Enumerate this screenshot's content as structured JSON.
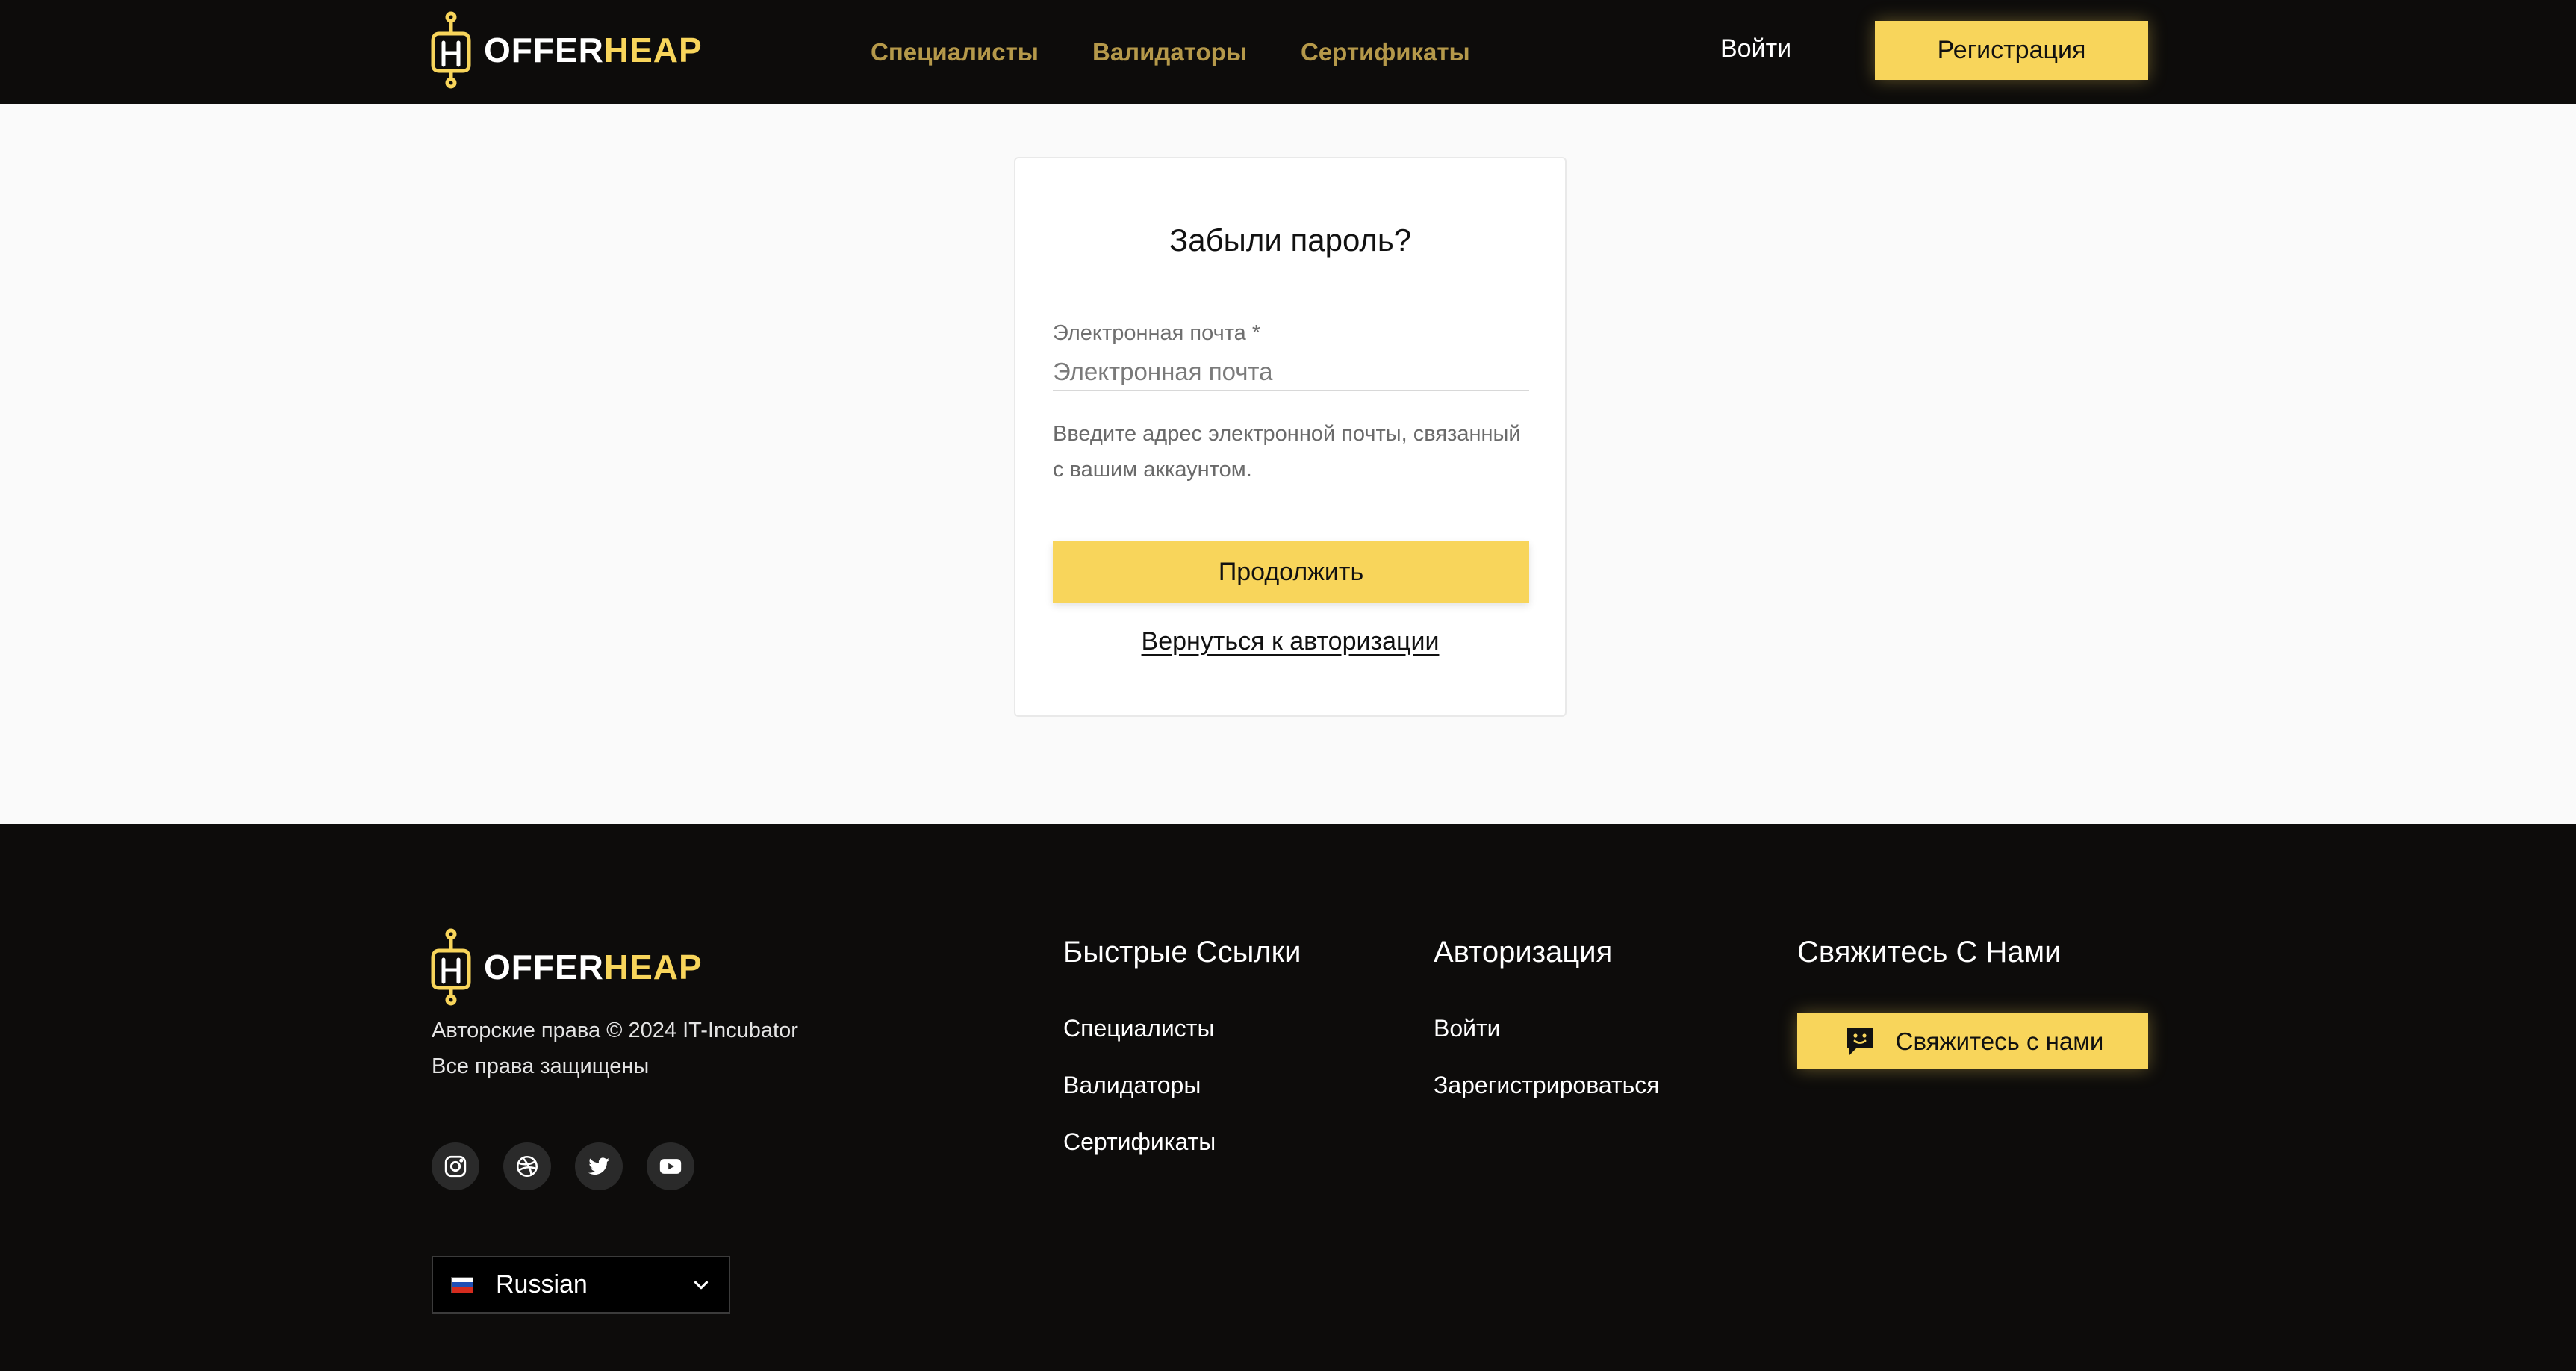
{
  "brand": {
    "word_part1": "OFFER",
    "word_part2": "HEAP"
  },
  "colors": {
    "accent": "#f8d55b",
    "dark": "#0d0c0b",
    "nav_link": "#b5994a"
  },
  "header": {
    "nav": [
      "Специалисты",
      "Валидаторы",
      "Сертификаты"
    ],
    "login_label": "Войти",
    "register_label": "Регистрация"
  },
  "form": {
    "title": "Забыли пароль?",
    "email_label": "Электронная почта *",
    "email_placeholder": "Электронная почта",
    "email_value": "",
    "helper_text": "Введите адрес электронной почты, связанный с вашим аккаунтом.",
    "continue_label": "Продолжить",
    "back_link": "Вернуться к авторизации"
  },
  "footer": {
    "copyright_line1": "Авторские права © 2024 IT-Incubator",
    "copyright_line2": "Все права защищены",
    "socials": [
      "instagram-icon",
      "dribbble-icon",
      "twitter-icon",
      "youtube-icon"
    ],
    "language": {
      "selected": "Russian",
      "flag_icon": "russia-flag-icon"
    },
    "quick_links": {
      "title": "Быстрые Ссылки",
      "items": [
        "Специалисты",
        "Валидаторы",
        "Сертификаты"
      ]
    },
    "auth": {
      "title": "Авторизация",
      "items": [
        "Войти",
        "Зарегистрироваться"
      ]
    },
    "contact": {
      "title": "Свяжитесь С Нами",
      "button_label": "Свяжитесь с нами",
      "button_icon": "chat-icon"
    }
  }
}
